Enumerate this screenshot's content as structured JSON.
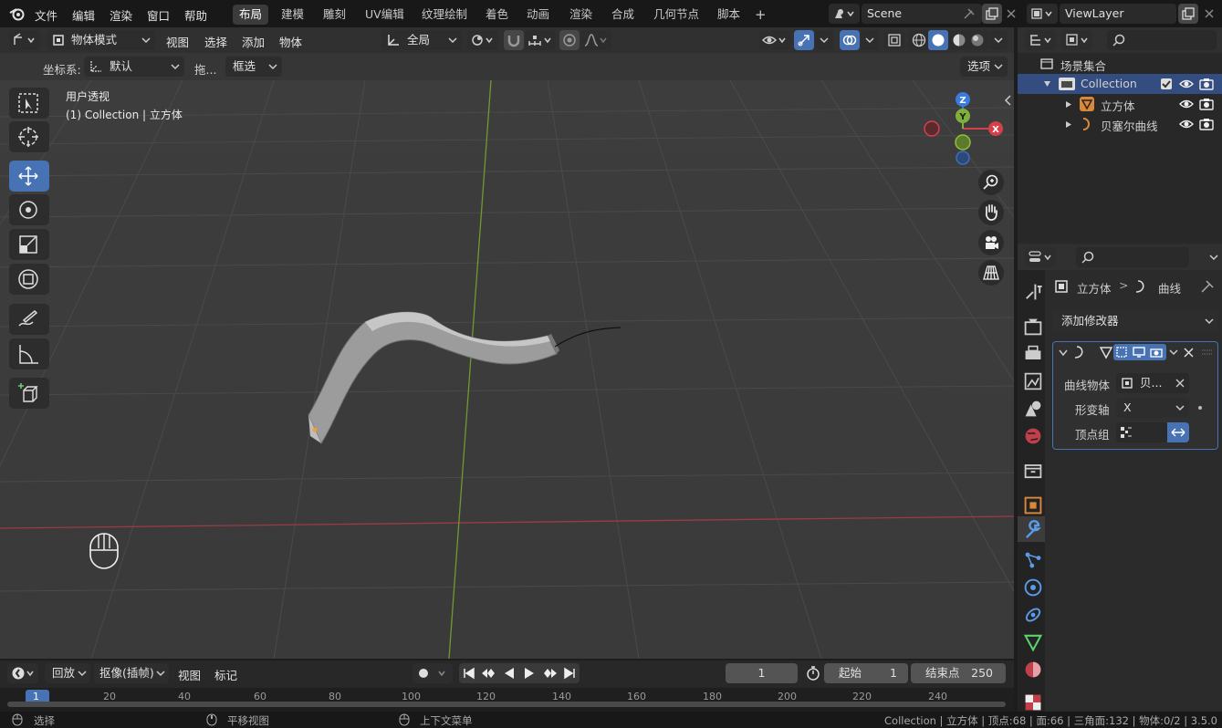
{
  "menu": {
    "items": [
      "文件",
      "编辑",
      "渲染",
      "窗口",
      "帮助"
    ]
  },
  "workspaces": {
    "tabs": [
      "布局",
      "建模",
      "雕刻",
      "UV编辑",
      "纹理绘制",
      "着色",
      "动画",
      "渲染",
      "合成",
      "几何节点",
      "脚本"
    ],
    "active": "布局",
    "add": "+"
  },
  "scene": {
    "name": "Scene",
    "view_layer": "ViewLayer"
  },
  "header": {
    "mode": "物体模式",
    "view": "视图",
    "select": "选择",
    "add": "添加",
    "object": "物体",
    "transform_orientation": "全局"
  },
  "tool_settings": {
    "coord_label": "坐标系:",
    "coord_value": "默认",
    "drag_label": "拖...",
    "drag_value": "框选",
    "options": "选项"
  },
  "viewport": {
    "view_name": "用户透视",
    "context": "(1) Collection | 立方体",
    "axes": {
      "z": "Z",
      "y": "Y",
      "x": "X"
    }
  },
  "outliner": {
    "root": "场景集合",
    "collection": "Collection",
    "items": [
      "立方体",
      "贝塞尔曲线"
    ]
  },
  "properties": {
    "breadcrumb_object": "立方体",
    "breadcrumb_sep": ">",
    "breadcrumb_data": "曲线",
    "add_modifier": "添加修改器",
    "curve_object_label": "曲线物体",
    "curve_object_value": "贝...",
    "deform_axis_label": "形变轴",
    "deform_axis_value": "X",
    "vertex_group_label": "顶点组"
  },
  "timeline": {
    "playback": "回放",
    "keying": "抠像(插帧)",
    "view": "视图",
    "marker": "标记",
    "current_frame": "1",
    "start_label": "起始",
    "start_value": "1",
    "end_label": "结束点",
    "end_value": "250",
    "ticks": [
      "1",
      "20",
      "40",
      "60",
      "80",
      "100",
      "120",
      "140",
      "160",
      "180",
      "200",
      "220",
      "240"
    ]
  },
  "statusbar": {
    "select": "选择",
    "pan": "平移视图",
    "context_menu": "上下文菜单",
    "stats": "Collection | 立方体 | 顶点:68 | 面:66 | 三角面:132 | 物体:0/2 | 3.5.0"
  },
  "colors": {
    "accent": "#4772b3",
    "x_axis": "#d5404a",
    "y_axis": "#7fb03a",
    "z_axis": "#3a7be0"
  }
}
